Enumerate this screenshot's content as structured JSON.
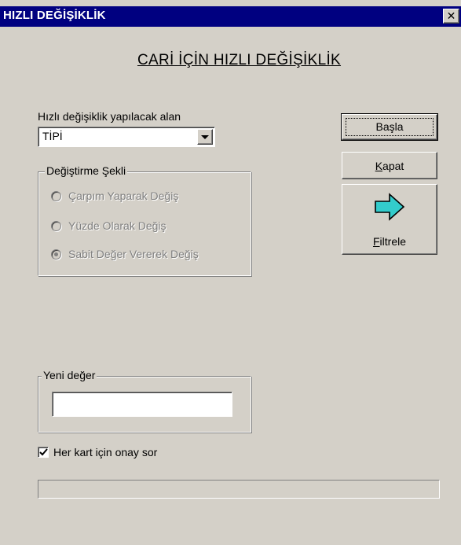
{
  "window": {
    "title": "HIZLI DEĞİŞİKLİK",
    "close_label": "✕"
  },
  "heading": "CARİ İÇİN HIZLI DEĞİŞİKLİK",
  "field_select": {
    "label": "Hızlı değişiklik yapılacak alan",
    "value": "TİPİ"
  },
  "change_method": {
    "legend": "Değiştirme Şekli",
    "options": [
      {
        "label": "Çarpım Yaparak Değiş",
        "selected": false
      },
      {
        "label": "Yüzde Olarak Değiş",
        "selected": false
      },
      {
        "label": "Sabit Değer Vererek Değiş",
        "selected": true
      }
    ],
    "enabled": false
  },
  "buttons": {
    "start_label": "Başla",
    "close_accel": "K",
    "close_rest": "apat",
    "filter_accel": "F",
    "filter_rest": "iltrele"
  },
  "new_value": {
    "legend": "Yeni değer",
    "value": ""
  },
  "confirm_checkbox": {
    "label": "Her kart için onay sor",
    "checked": true
  },
  "progress": {
    "value": 0
  },
  "icons": {
    "close": "close-icon",
    "filter": "arrow-right-icon",
    "dropdown": "chevron-down-icon"
  },
  "colors": {
    "titlebar": "#000080",
    "face": "#d4d0c8",
    "arrow_fill": "#33cccc"
  }
}
